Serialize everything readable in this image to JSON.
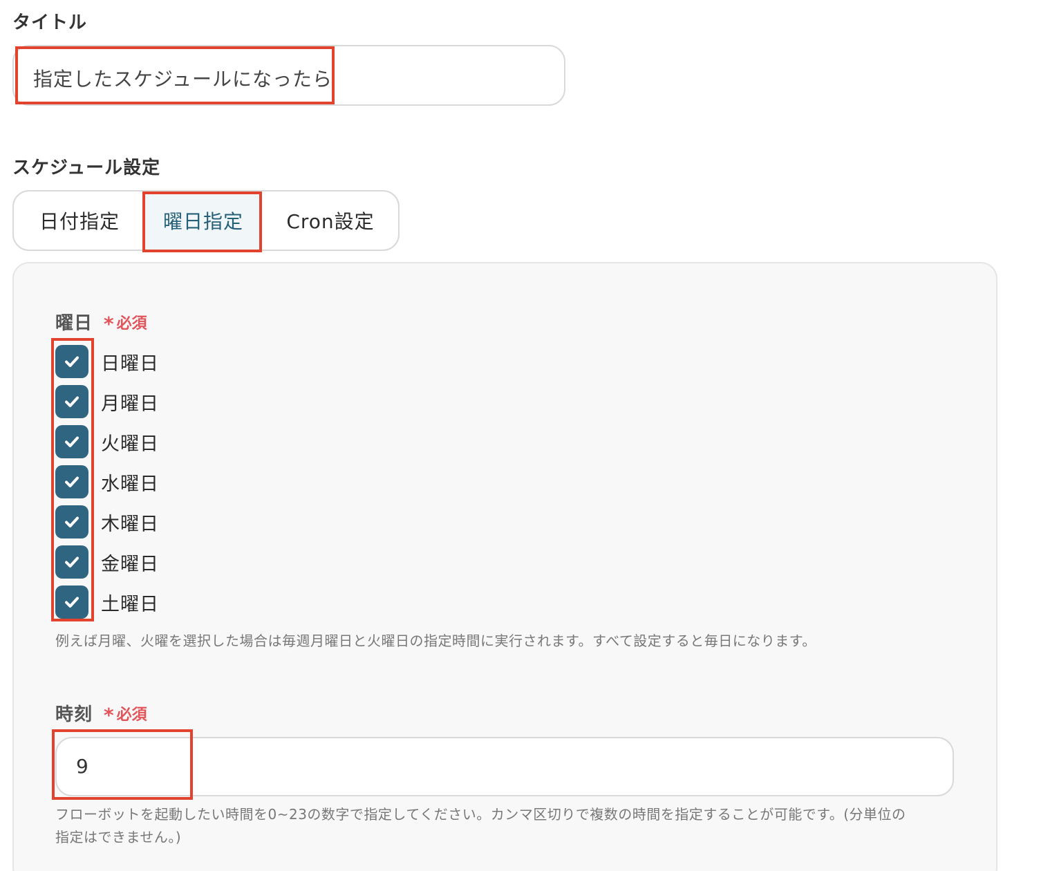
{
  "title_section": {
    "label": "タイトル",
    "input_value": "指定したスケジュールになったら"
  },
  "schedule_section": {
    "label": "スケジュール設定",
    "tabs": [
      {
        "label": "日付指定",
        "selected": false
      },
      {
        "label": "曜日指定",
        "selected": true
      },
      {
        "label": "Cron設定",
        "selected": false
      }
    ]
  },
  "weekday_field": {
    "label": "曜日",
    "required_star": "*",
    "required_text": "必須",
    "days": [
      {
        "label": "日曜日",
        "checked": true
      },
      {
        "label": "月曜日",
        "checked": true
      },
      {
        "label": "火曜日",
        "checked": true
      },
      {
        "label": "水曜日",
        "checked": true
      },
      {
        "label": "木曜日",
        "checked": true
      },
      {
        "label": "金曜日",
        "checked": true
      },
      {
        "label": "土曜日",
        "checked": true
      }
    ],
    "help": "例えば月曜、火曜を選択した場合は毎週月曜日と火曜日の指定時間に実行されます。すべて設定すると毎日になります。"
  },
  "time_field": {
    "label": "時刻",
    "required_star": "*",
    "required_text": "必須",
    "input_value": "9",
    "help_line1": "フローボットを起動したい時間を0~23の数字で指定してください。カンマ区切りで複数の時間を指定することが可能です。(分単位の",
    "help_line2": "指定はできません。)"
  },
  "colors": {
    "accent": "#2f6581",
    "required": "#e2545a",
    "highlight_box": "#e2432f",
    "selected_tab_bg": "#f1f7f9"
  }
}
